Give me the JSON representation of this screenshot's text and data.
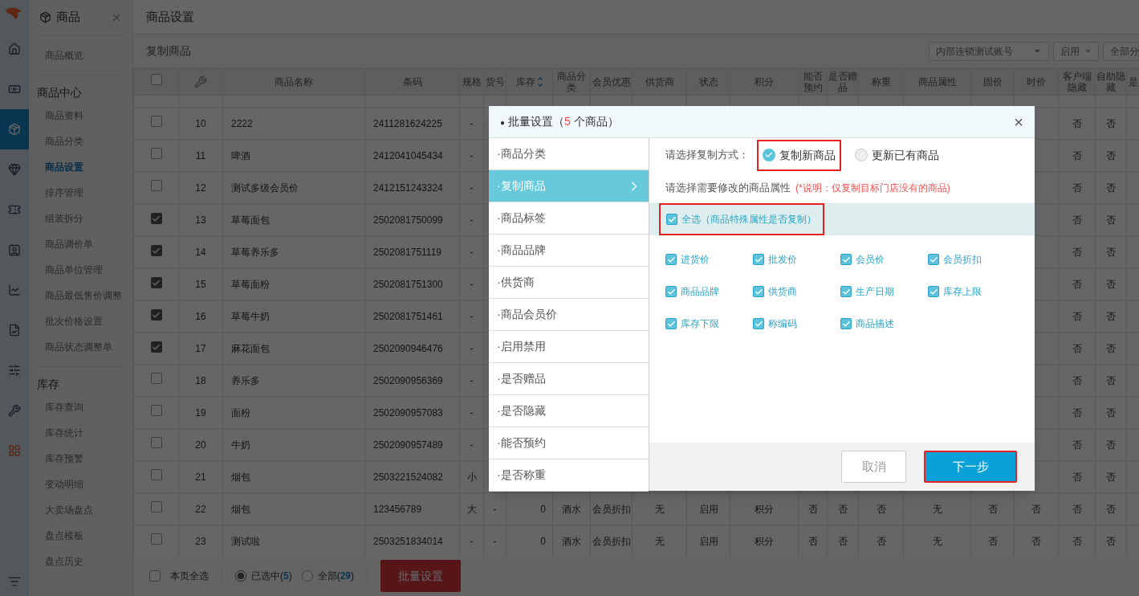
{
  "rail": {
    "items": [
      {
        "selected": false
      },
      {
        "selected": false
      },
      {
        "selected": true
      },
      {
        "selected": false
      },
      {
        "selected": false
      },
      {
        "selected": false
      },
      {
        "selected": false
      },
      {
        "selected": false
      },
      {
        "selected": false
      },
      {
        "selected": false
      },
      {
        "selected": false
      }
    ]
  },
  "sidebar": {
    "title": "商品",
    "overview": "商品概览",
    "sections": [
      {
        "heading": "商品中心",
        "items": [
          {
            "label": "商品资料",
            "selected": false
          },
          {
            "label": "商品分类",
            "selected": false
          },
          {
            "label": "商品设置",
            "selected": true
          },
          {
            "label": "排序管理",
            "selected": false
          },
          {
            "label": "组装拆分",
            "selected": false
          },
          {
            "label": "商品调价单",
            "selected": false
          },
          {
            "label": "商品单位管理",
            "selected": false
          },
          {
            "label": "商品最低售价调整",
            "selected": false
          },
          {
            "label": "批次价格设置",
            "selected": false
          },
          {
            "label": "商品状态调整单",
            "selected": false
          }
        ]
      },
      {
        "heading": "库存",
        "items": [
          {
            "label": "库存查询",
            "selected": false
          },
          {
            "label": "库存统计",
            "selected": false
          },
          {
            "label": "库存预警",
            "selected": false
          },
          {
            "label": "变动明细",
            "selected": false
          },
          {
            "label": "大卖场盘点",
            "selected": false
          },
          {
            "label": "盘点模板",
            "selected": false
          },
          {
            "label": "盘点历史",
            "selected": false
          }
        ]
      }
    ]
  },
  "page_title": "商品设置",
  "sub_title": "复制商品",
  "filters": [
    "内部连锁测试账号",
    "启用",
    "全部分"
  ],
  "table": {
    "select_all_checked": false,
    "columns": [
      {
        "label": "商品名称",
        "sortable": false
      },
      {
        "label": "条码",
        "sortable": false
      },
      {
        "label": "规格",
        "sortable": false
      },
      {
        "label": "货号",
        "sortable": false
      },
      {
        "label": "库存",
        "sortable": true
      },
      {
        "label": "商品分类",
        "sortable": false
      },
      {
        "label": "会员优惠",
        "sortable": false
      },
      {
        "label": "供货商",
        "sortable": false
      },
      {
        "label": "状态",
        "sortable": false
      },
      {
        "label": "积分",
        "sortable": false
      },
      {
        "label": "能否预约",
        "sortable": false
      },
      {
        "label": "是否赠品",
        "sortable": false
      },
      {
        "label": "称重",
        "sortable": false
      },
      {
        "label": "商品属性",
        "sortable": false
      },
      {
        "label": "固价",
        "sortable": false
      },
      {
        "label": "时价",
        "sortable": false
      },
      {
        "label": "客户端隐藏",
        "sortable": false
      },
      {
        "label": "自助隐藏",
        "sortable": false
      },
      {
        "label": "是",
        "sortable": false
      }
    ],
    "rows": [
      {
        "checked": false,
        "number": "10",
        "cells": [
          "2222",
          "2411281624225",
          "-"
        ],
        "end_cells": [
          "否",
          "否"
        ]
      },
      {
        "checked": false,
        "number": "11",
        "cells": [
          "啤酒",
          "2412041045434",
          "-"
        ],
        "end_cells": [
          "否",
          "否"
        ]
      },
      {
        "checked": false,
        "number": "12",
        "cells": [
          "测试多级会员价",
          "2412151243324",
          "-"
        ],
        "end_cells": [
          "否",
          "否"
        ]
      },
      {
        "checked": true,
        "number": "13",
        "cells": [
          "草莓面包",
          "2502081750099",
          "-"
        ],
        "end_cells": [
          "否",
          "否"
        ]
      },
      {
        "checked": true,
        "number": "14",
        "cells": [
          "草莓养乐多",
          "2502081751119",
          "-"
        ],
        "end_cells": [
          "否",
          "否"
        ]
      },
      {
        "checked": true,
        "number": "15",
        "cells": [
          "草莓面粉",
          "2502081751300",
          "-"
        ],
        "end_cells": [
          "否",
          "否"
        ]
      },
      {
        "checked": true,
        "number": "16",
        "cells": [
          "草莓牛奶",
          "2502081751461",
          "-"
        ],
        "end_cells": [
          "否",
          "否"
        ]
      },
      {
        "checked": true,
        "number": "17",
        "cells": [
          "麻花面包",
          "2502090946476",
          "-"
        ],
        "end_cells": [
          "否",
          "否"
        ]
      },
      {
        "checked": false,
        "number": "18",
        "cells": [
          "养乐多",
          "2502090956369",
          "-"
        ],
        "end_cells": [
          "否",
          "否"
        ]
      },
      {
        "checked": false,
        "number": "19",
        "cells": [
          "面粉",
          "2502090957083",
          "-"
        ],
        "end_cells": [
          "否",
          "否"
        ]
      },
      {
        "checked": false,
        "number": "20",
        "cells": [
          "牛奶",
          "2502090957489",
          "-"
        ],
        "end_cells": [
          "否",
          "否"
        ]
      },
      {
        "checked": false,
        "number": "21",
        "cells": [
          "烟包",
          "2503221524082",
          "小"
        ],
        "end_cells": [
          "否",
          "否"
        ]
      },
      {
        "checked": false,
        "number": "22",
        "cells": [
          "烟包",
          "123456789",
          "大",
          "-",
          "0",
          "酒水",
          "会员折扣",
          "无",
          "启用",
          "积分",
          "否",
          "否",
          "否",
          "无",
          "否",
          "否",
          "否",
          "否"
        ]
      },
      {
        "checked": false,
        "number": "23",
        "cells": [
          "测试啦",
          "2503251834014",
          "-",
          "-",
          "0",
          "酒水",
          "会员折扣",
          "无",
          "启用",
          "积分",
          "否",
          "否",
          "否",
          "无",
          "否",
          "否",
          "否",
          "否"
        ]
      }
    ]
  },
  "footer": {
    "page_select": {
      "label": "本页全选",
      "checked": false
    },
    "scopes": [
      {
        "label": "已选中(**5**)",
        "selected": true
      },
      {
        "label": "全部(**29**)",
        "selected": false
      }
    ],
    "batch_button": "批量设置"
  },
  "dialog": {
    "bullet": "●",
    "title": "批量设置（",
    "count": "5",
    "title_suffix": " 个商品）",
    "close": "×",
    "menu": [
      {
        "label": "·商品分类",
        "selected": false
      },
      {
        "label": "·复制商品",
        "selected": true
      },
      {
        "label": "·商品标签",
        "selected": false
      },
      {
        "label": "·商品品牌",
        "selected": false
      },
      {
        "label": "·供货商",
        "selected": false
      },
      {
        "label": "·商品会员价",
        "selected": false
      },
      {
        "label": "·启用禁用",
        "selected": false
      },
      {
        "label": "·是否赠品",
        "selected": false
      },
      {
        "label": "·是否隐藏",
        "selected": false
      },
      {
        "label": "·能否预约",
        "selected": false
      },
      {
        "label": "·是否称重",
        "selected": false
      }
    ],
    "method_label": "请选择复制方式：",
    "methods": [
      {
        "label": "复制新商品",
        "selected": true,
        "highlighted": true
      },
      {
        "label": "更新已有商品",
        "selected": false,
        "highlighted": false
      }
    ],
    "attributes_label": "请选择需要修改的商品属性",
    "note": "(*说明：仅复制目标门店没有的商品)",
    "select_all": {
      "label": "全选（商品特殊属性是否复制）",
      "checked": true,
      "highlighted": true
    },
    "attributes": [
      {
        "label": "进货价",
        "checked": true
      },
      {
        "label": "批发价",
        "checked": true
      },
      {
        "label": "会员价",
        "checked": true
      },
      {
        "label": "会员折扣",
        "checked": true
      },
      {
        "label": "商品品牌",
        "checked": true
      },
      {
        "label": "供货商",
        "checked": true
      },
      {
        "label": "生产日期",
        "checked": true
      },
      {
        "label": "库存上限",
        "checked": true
      },
      {
        "label": "库存下限",
        "checked": true
      },
      {
        "label": "称编码",
        "checked": true
      },
      {
        "label": "商品描述",
        "checked": true
      }
    ],
    "cancel": "取消",
    "next": {
      "label": "下一步",
      "highlighted": true
    }
  }
}
